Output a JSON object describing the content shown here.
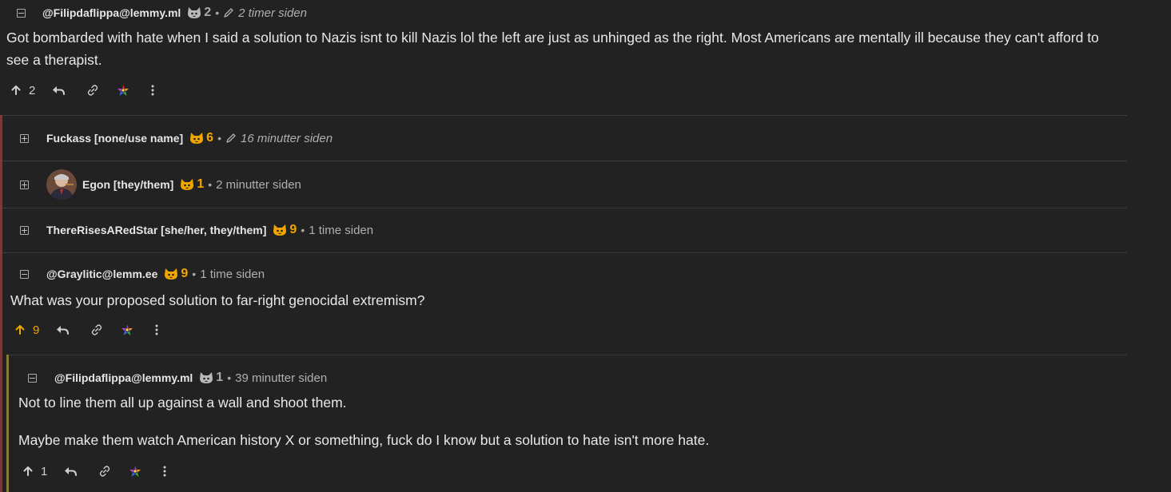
{
  "colors": {
    "accent_gold": "#f0a500",
    "thread_edge_1": "#7a3a3a",
    "thread_edge_2": "#8a7a3a",
    "background": "#222222"
  },
  "comments": [
    {
      "user": "@Filipdaflippa@lemmy.ml",
      "score": "2",
      "score_icon": "cat-paw-icon-grey",
      "time": "2 timer siden",
      "edited": true,
      "toggle": "−",
      "body": [
        "Got bombarded with hate when I said a solution to Nazis isnt to kill Nazis lol the left are just as unhinged as the right. Most Americans are mentally ill because they can't afford to see a therapist."
      ],
      "votes": "2"
    },
    {
      "user": "Fuckass [none/use name]",
      "score": "6",
      "time": "16 minutter siden",
      "edited": true,
      "toggle": "+"
    },
    {
      "user": "Egon [they/them]",
      "score": "1",
      "time": "2 minutter siden",
      "toggle": "+",
      "has_avatar": true
    },
    {
      "user": "ThereRisesARedStar [she/her, they/them]",
      "score": "9",
      "time": "1 time siden",
      "toggle": "+"
    },
    {
      "user": "@Graylitic@lemm.ee",
      "score": "9",
      "time": "1 time siden",
      "toggle": "−",
      "body": [
        "What was your proposed solution to far-right genocidal extremism?"
      ],
      "votes": "9"
    },
    {
      "user": "@Filipdaflippa@lemmy.ml",
      "score": "1",
      "score_icon": "cat-paw-icon-grey",
      "time": "39 minutter siden",
      "toggle": "−",
      "body": [
        "Not to line them all up against a wall and shoot them.",
        "Maybe make them watch American history X or something, fuck do I know but a solution to hate isn't more hate."
      ],
      "votes": "1"
    }
  ],
  "icons": [
    "upvote-arrow-icon",
    "reply-icon",
    "link-icon",
    "rainbow-star-icon",
    "more-options-icon",
    "pencil-icon",
    "cat-paw-icon"
  ]
}
